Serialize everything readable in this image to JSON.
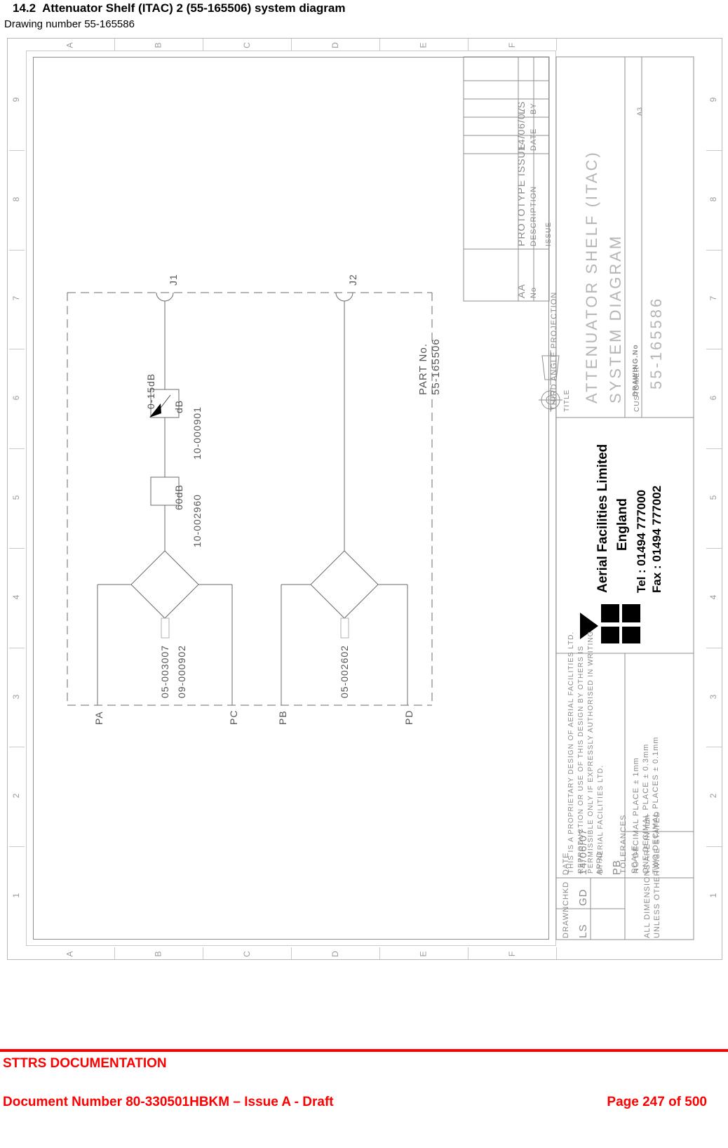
{
  "document": {
    "section_number": "14.2",
    "section_title": "Attenuator Shelf (ITAC) 2 (55-165506) system diagram",
    "drawing_line": "Drawing number 55-165586"
  },
  "footer": {
    "doc_class": "STTRS DOCUMENTATION",
    "doc_number": "Document Number 80-330501HBKM – Issue A - Draft",
    "page": "Page 247 of 500",
    "color": "#ff0000"
  },
  "frame": {
    "column_letters": [
      "A",
      "B",
      "C",
      "D",
      "E",
      "F"
    ],
    "row_numbers": [
      "9",
      "8",
      "7",
      "6",
      "5",
      "4",
      "3",
      "2",
      "1"
    ]
  },
  "schematic": {
    "part_label": "PART No.",
    "part_number": "55-165506",
    "connectors": [
      {
        "name": "J1"
      },
      {
        "name": "J2"
      }
    ],
    "attenuator_variable": {
      "box_label": "dB",
      "range": "0-15dB",
      "part": "10-000901"
    },
    "attenuator_fixed": {
      "box_label": "60dB",
      "part": "10-002960"
    },
    "splitter_left": {
      "part": "05-003007",
      "load_part": "09-000902"
    },
    "splitter_right": {
      "part": "05-002602"
    },
    "ports": [
      "PA",
      "PC",
      "PB",
      "PD"
    ]
  },
  "titleblock": {
    "revision_table": {
      "headers": {
        "no": "No",
        "description": "DESCRIPTION",
        "date": "DATE",
        "by": "BY"
      },
      "caption": "ISSUE",
      "rows": [
        {
          "no": "AA",
          "description": "PROTOTYPE ISSUE",
          "date": "14/06/07",
          "by": "LS"
        }
      ]
    },
    "projection": "THIRD ANGLE PROJECTION",
    "title_label": "TITLE",
    "title_line1": "ATTENUATOR SHELF (ITAC)",
    "title_line2": "SYSTEM DIAGRAM",
    "customer_label": "CUSTOMER",
    "drawing_no_label": "DRAWING.No",
    "drawing_no": "55-165586",
    "sheet_size": "A3",
    "company": {
      "name": "Aerial Facilities Limited",
      "country": "England",
      "tel": "Tel : 01494 777000",
      "fax": "Fax : 01494 777002"
    },
    "proprietary_notice": [
      "THIS IS A PROPRIETARY DESIGN OF AERIAL FACILITIES LTD.",
      "REPRODUCTION OR USE OF THIS DESIGN BY OTHERS IS",
      "PERMISSIBLE ONLY IF EXPRESSLY AUTHORISED IN WRITING",
      "BY AERIAL FACILITIES LTD."
    ],
    "scale_label": "SCALE",
    "scale_value": "–",
    "tolerances_label": "TOLERANCES",
    "tolerances": [
      "NO DECIMAL PLACE ± 1mm",
      "ONE DECIMAL PLACE ± 0.3mm",
      "TWO DECIMAL PLACES ± 0.1mm"
    ],
    "units_note": [
      "ALL DIMENSIONS ARE IN mm",
      "UNLESS OTHERWISE STATED"
    ],
    "signoff": {
      "drawn_label": "DRAWN",
      "drawn_value": "LS",
      "chkd_label": "CHKD",
      "chkd_value": "GD",
      "appd_label": "APPD",
      "appd_value": "PB",
      "date_label": "DATE",
      "date_value": "14/06/07"
    }
  }
}
